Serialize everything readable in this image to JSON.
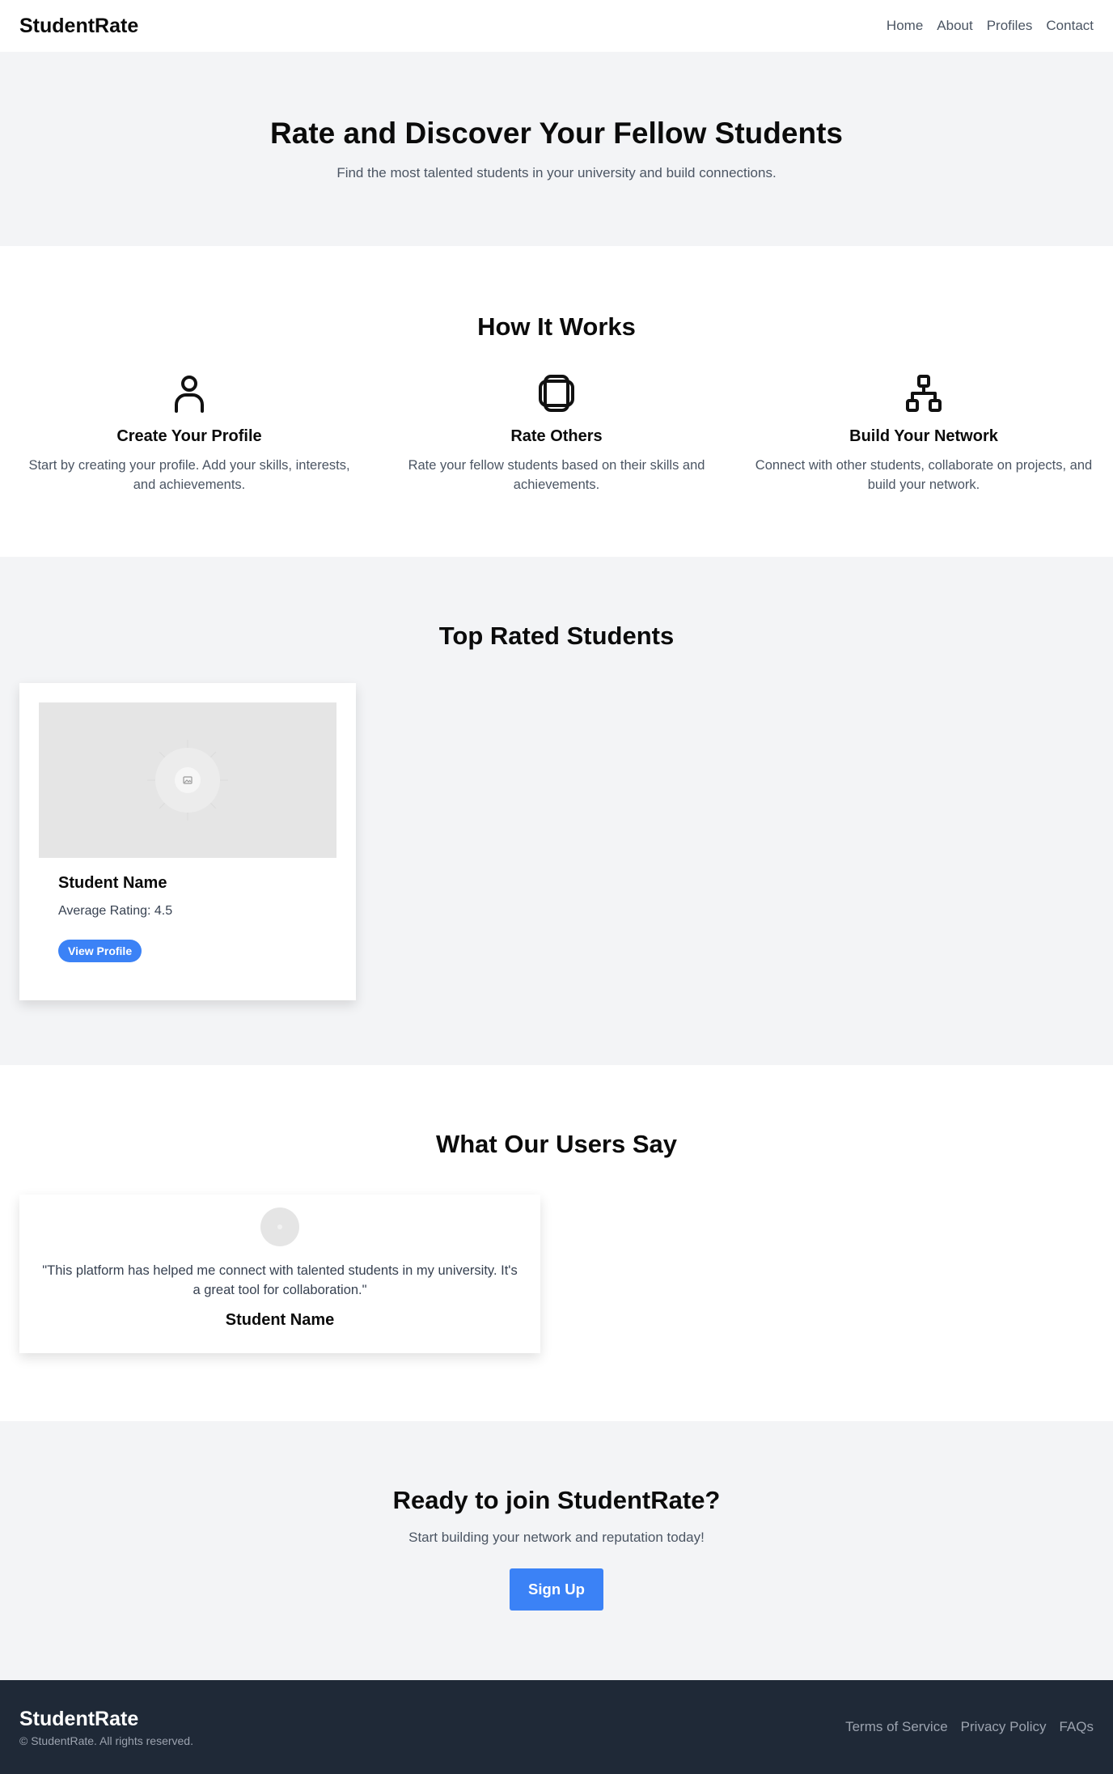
{
  "header": {
    "brand": "StudentRate",
    "nav": [
      "Home",
      "About",
      "Profiles",
      "Contact"
    ]
  },
  "hero": {
    "title": "Rate and Discover Your Fellow Students",
    "subtitle": "Find the most talented students in your university and build connections."
  },
  "how": {
    "title": "How It Works",
    "steps": [
      {
        "icon": "user-icon",
        "title": "Create Your Profile",
        "text": "Start by creating your profile. Add your skills, interests, and achievements."
      },
      {
        "icon": "layers-icon",
        "title": "Rate Others",
        "text": "Rate your fellow students based on their skills and achievements."
      },
      {
        "icon": "network-icon",
        "title": "Build Your Network",
        "text": "Connect with other students, collaborate on projects, and build your network."
      }
    ]
  },
  "top_rated": {
    "title": "Top Rated Students",
    "card": {
      "name": "Student Name",
      "rating": "Average Rating: 4.5",
      "button": "View Profile"
    }
  },
  "testimonials": {
    "title": "What Our Users Say",
    "quote": "\"This platform has helped me connect with talented students in my university. It's a great tool for collaboration.\"",
    "name": "Student Name"
  },
  "cta": {
    "title": "Ready to join StudentRate?",
    "subtitle": "Start building your network and reputation today!",
    "button": "Sign Up"
  },
  "footer": {
    "brand": "StudentRate",
    "copyright": "© StudentRate. All rights reserved.",
    "links": [
      "Terms of Service",
      "Privacy Policy",
      "FAQs"
    ]
  },
  "colors": {
    "accent": "#3b82f6",
    "footer_bg": "#1f2937",
    "section_alt_bg": "#f3f4f6"
  }
}
